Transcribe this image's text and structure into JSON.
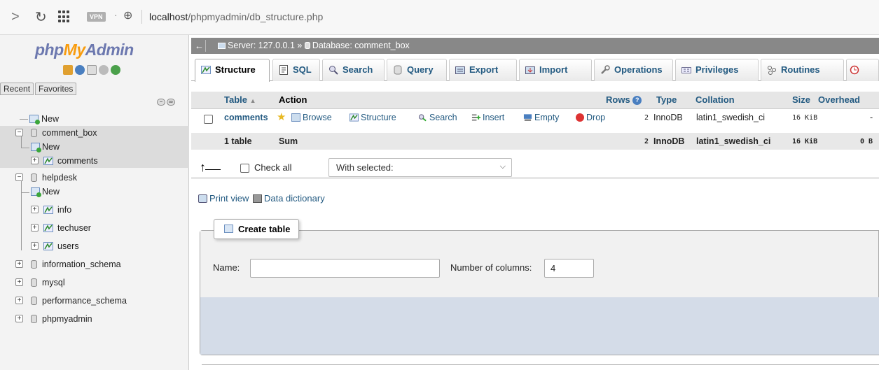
{
  "browser": {
    "url_host": "localhost",
    "url_path": "/phpmyadmin/db_structure.php",
    "vpn_label": "VPN"
  },
  "sidebar": {
    "logo": {
      "php": "php",
      "my": "My",
      "admin": "Admin"
    },
    "tabs": [
      "Recent",
      "Favorites"
    ],
    "tree": [
      {
        "label": "New",
        "type": "new",
        "level": 0
      },
      {
        "label": "comment_box",
        "type": "db",
        "level": 0,
        "selected": true
      },
      {
        "label": "New",
        "type": "new",
        "level": 1,
        "selected": true
      },
      {
        "label": "comments",
        "type": "table",
        "level": 1,
        "selected": true
      },
      {
        "label": "helpdesk",
        "type": "db",
        "level": 0
      },
      {
        "label": "New",
        "type": "new",
        "level": 1
      },
      {
        "label": "info",
        "type": "table",
        "level": 1
      },
      {
        "label": "techuser",
        "type": "table",
        "level": 1
      },
      {
        "label": "users",
        "type": "table",
        "level": 1
      },
      {
        "label": "information_schema",
        "type": "db",
        "level": 0
      },
      {
        "label": "mysql",
        "type": "db",
        "level": 0
      },
      {
        "label": "performance_schema",
        "type": "db",
        "level": 0
      },
      {
        "label": "phpmyadmin",
        "type": "db",
        "level": 0
      }
    ]
  },
  "breadcrumb": {
    "server": "Server: 127.0.0.1",
    "separator": "»",
    "database": "Database: comment_box"
  },
  "tabs": [
    {
      "label": "Structure",
      "active": true
    },
    {
      "label": "SQL"
    },
    {
      "label": "Search"
    },
    {
      "label": "Query"
    },
    {
      "label": "Export"
    },
    {
      "label": "Import"
    },
    {
      "label": "Operations"
    },
    {
      "label": "Privileges"
    },
    {
      "label": "Routines"
    }
  ],
  "table_list": {
    "headers": {
      "table": "Table",
      "sort": "▲",
      "action": "Action",
      "rows": "Rows",
      "type": "Type",
      "collation": "Collation",
      "size": "Size",
      "overhead": "Overhead"
    },
    "row": {
      "name": "comments",
      "actions": [
        "Browse",
        "Structure",
        "Search",
        "Insert",
        "Empty",
        "Drop"
      ],
      "rows": "2",
      "type": "InnoDB",
      "collation": "latin1_swedish_ci",
      "size": "16 KiB",
      "overhead": "-"
    },
    "sum": {
      "label": "1 table",
      "sum_label": "Sum",
      "rows": "2",
      "type": "InnoDB",
      "collation": "latin1_swedish_ci",
      "size": "16 KiB",
      "overhead": "0 B"
    }
  },
  "bulk": {
    "check_all": "Check all",
    "with_selected": "With selected:"
  },
  "links": {
    "print_view": "Print view",
    "data_dictionary": "Data dictionary"
  },
  "create_table": {
    "legend": "Create table",
    "name_label": "Name:",
    "columns_label": "Number of columns:",
    "columns_value": "4"
  }
}
